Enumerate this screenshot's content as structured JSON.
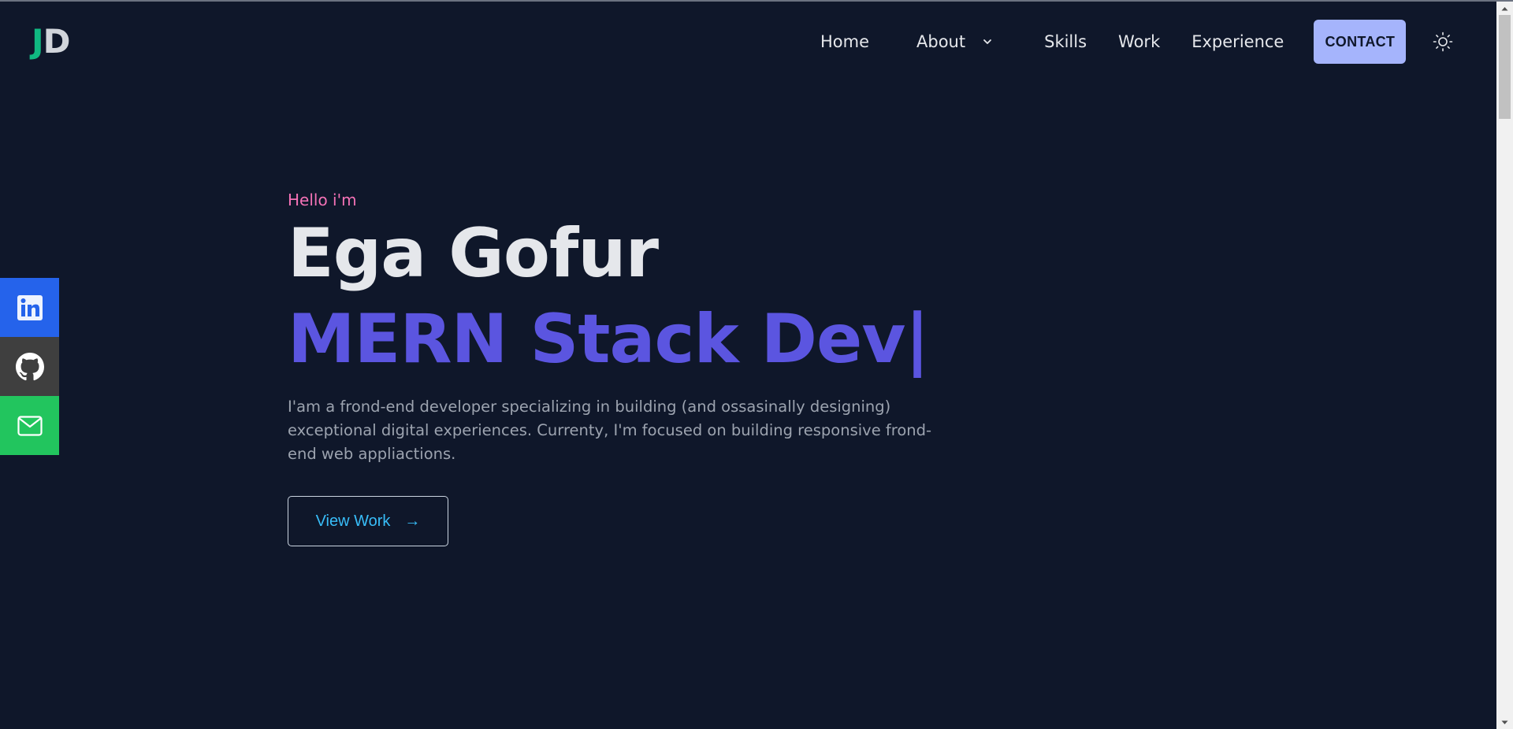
{
  "logo": {
    "first": "J",
    "second": "D"
  },
  "nav": {
    "home": "Home",
    "about": "About",
    "skills": "Skills",
    "work": "Work",
    "experience": "Experience",
    "contact": "CONTACT"
  },
  "social": [
    {
      "icon": "linkedin-icon",
      "color": "#2563eb"
    },
    {
      "icon": "github-icon",
      "color": "#3f3f3f"
    },
    {
      "icon": "mail-icon",
      "color": "#22c55e"
    }
  ],
  "hero": {
    "greeting": "Hello i'm",
    "name": "Ega Gofur",
    "role": "MERN Stack Dev|",
    "description": "I'am a frond-end developer specializing in building (and ossasinally designing) exceptional digital experiences. Currenty, I'm focused on building responsive frond-end web appliactions.",
    "cta": "View Work",
    "cta_arrow": "→"
  },
  "colors": {
    "background": "#0f172a",
    "accent_role": "#5b55e0",
    "greeting": "#f472b6",
    "contact_button": "#a5b4fc",
    "cta_text": "#38bdf8",
    "logo_j": "#10b981"
  }
}
